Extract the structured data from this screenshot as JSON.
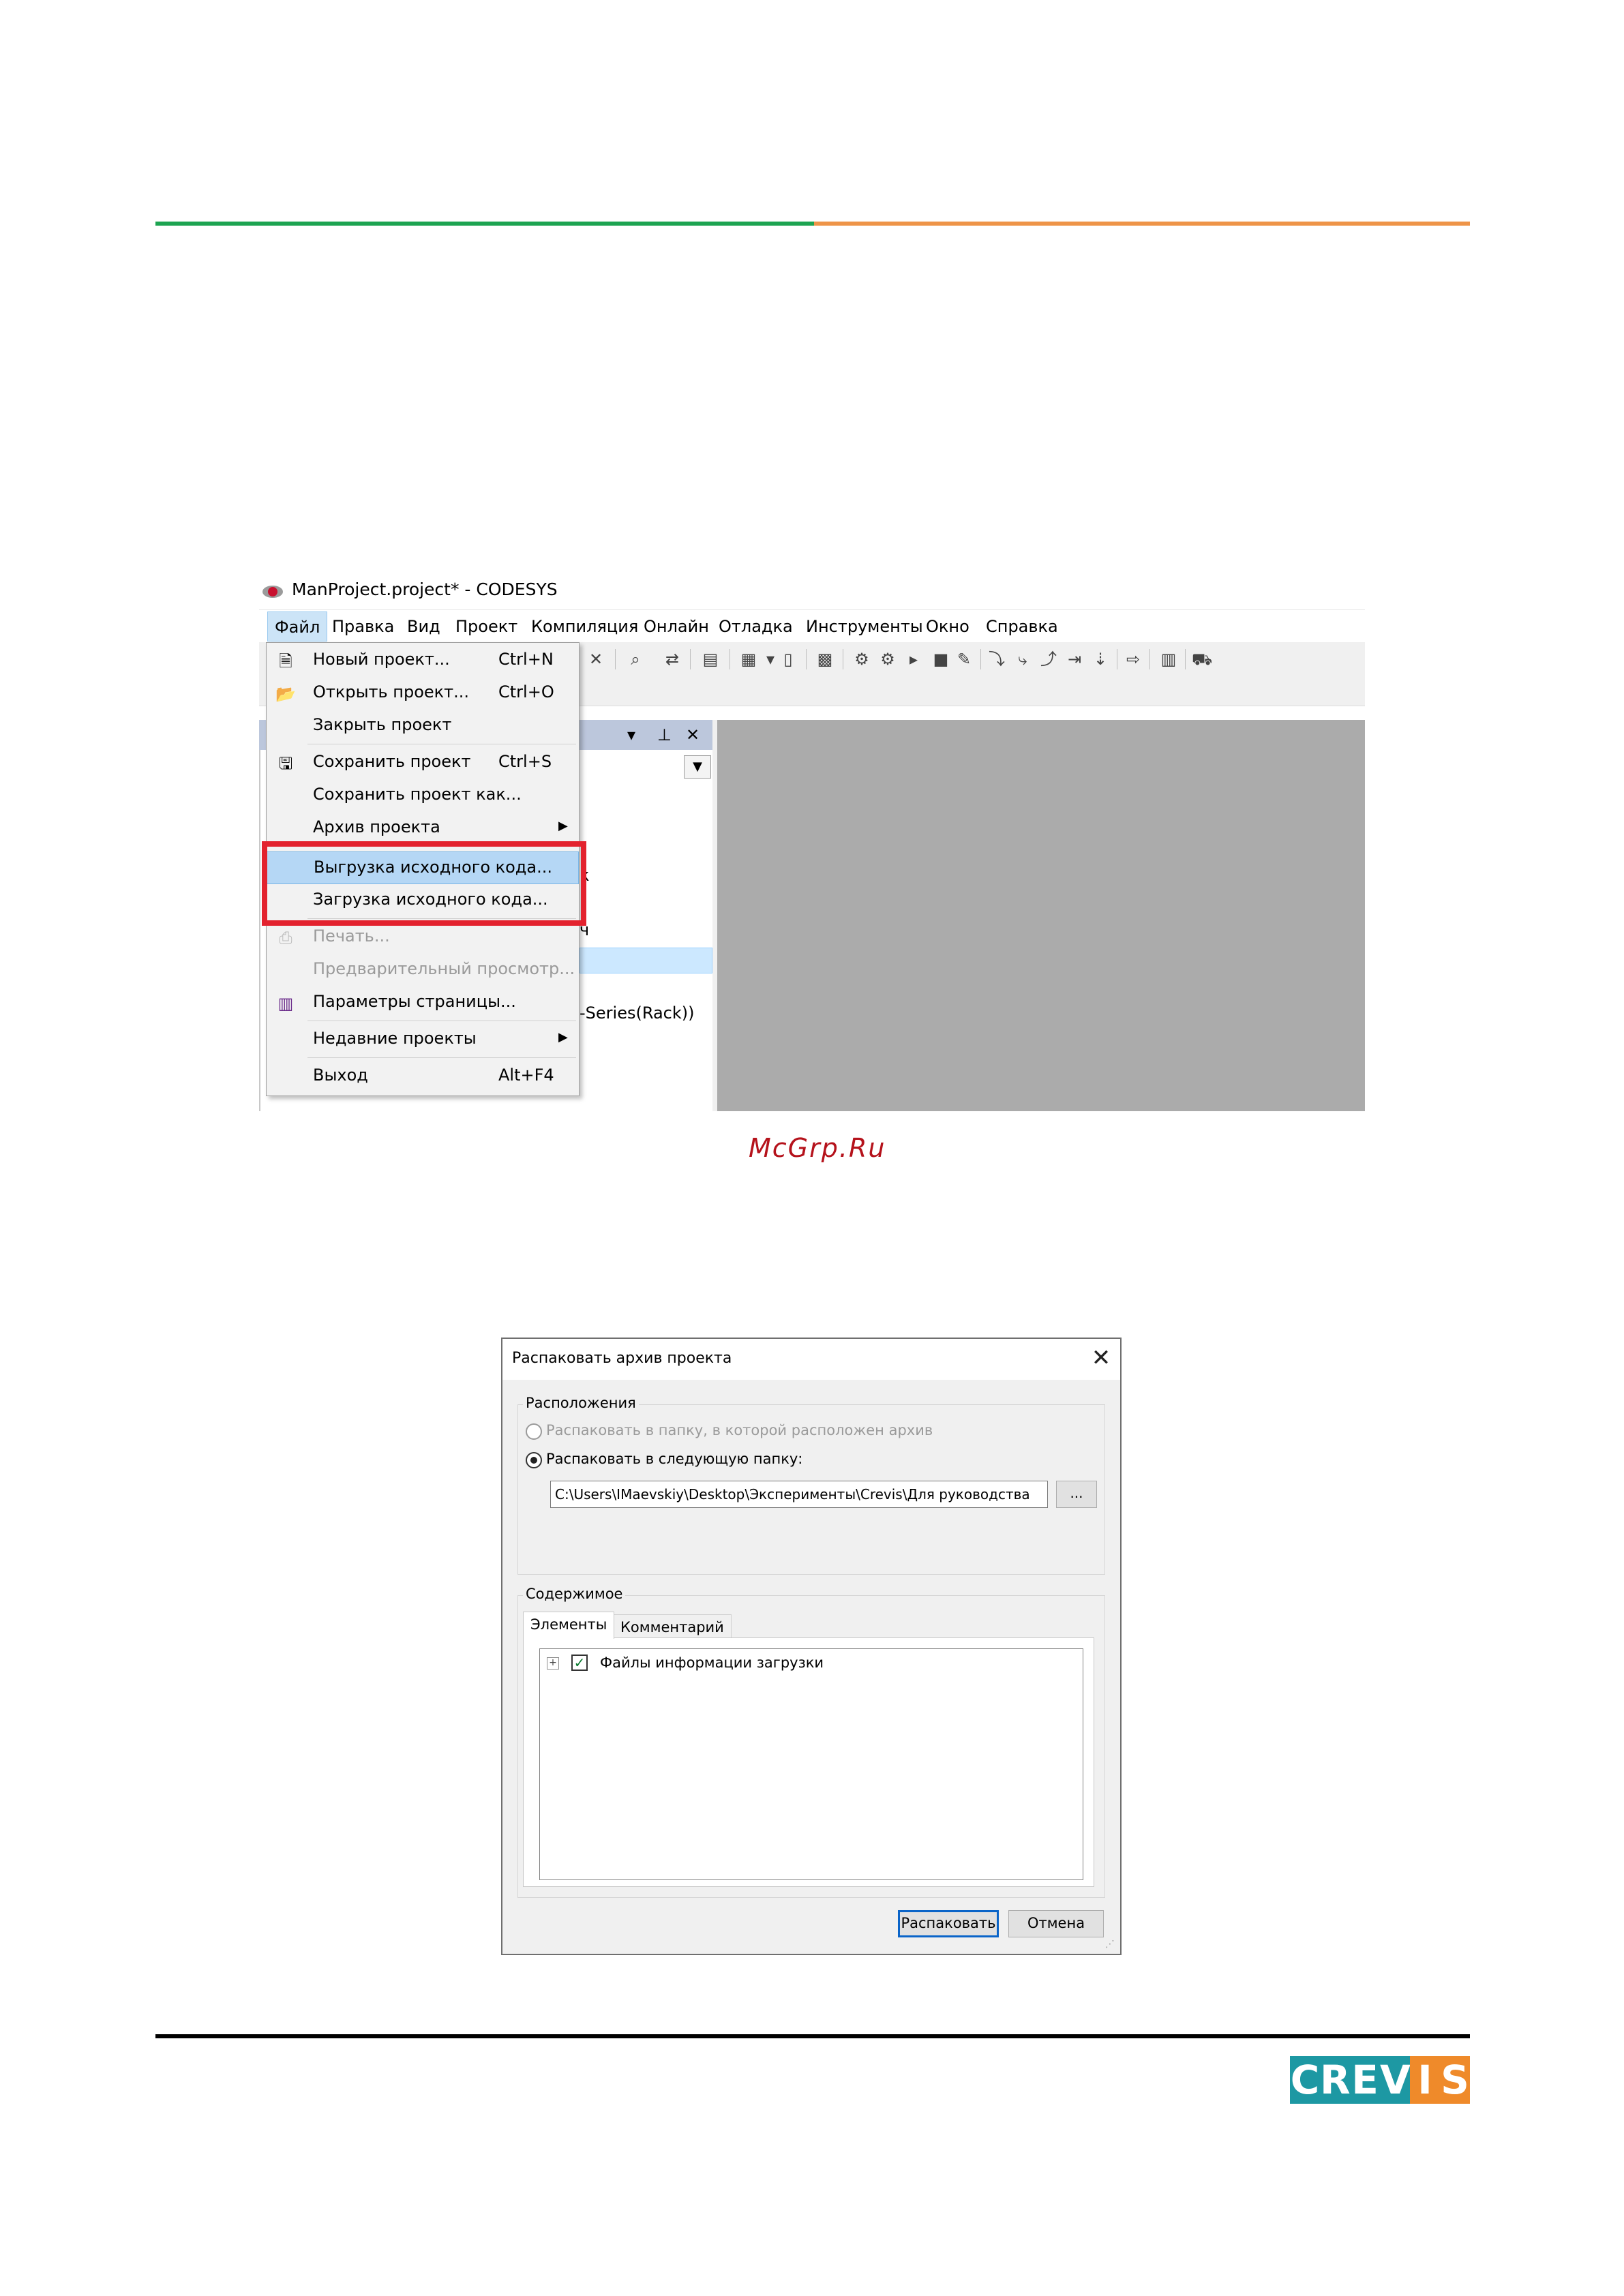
{
  "codesys": {
    "window_title": "ManProject.project* - CODESYS",
    "menubar": [
      "Файл",
      "Правка",
      "Вид",
      "Проект",
      "Компиляция",
      "Онлайн",
      "Отладка",
      "Инструменты",
      "Окно",
      "Справка"
    ],
    "file_menu": {
      "new": {
        "label": "Новый проект...",
        "shortcut": "Ctrl+N"
      },
      "open": {
        "label": "Открыть проект...",
        "shortcut": "Ctrl+O"
      },
      "close": {
        "label": "Закрыть проект"
      },
      "save": {
        "label": "Сохранить проект",
        "shortcut": "Ctrl+S"
      },
      "save_as": {
        "label": "Сохранить проект как..."
      },
      "archive": {
        "label": "Архив проекта"
      },
      "export_source": {
        "label": "Выгрузка исходного кода..."
      },
      "import_source": {
        "label": "Загрузка исходного кода..."
      },
      "print": {
        "label": "Печать..."
      },
      "preview": {
        "label": "Предварительный просмотр..."
      },
      "page_setup": {
        "label": "Параметры страницы..."
      },
      "recent": {
        "label": "Недавние проекты"
      },
      "exit": {
        "label": "Выход",
        "shortcut": "Alt+F4"
      }
    },
    "tree_fragments": {
      "frag1": "к",
      "frag2": "ч",
      "frag3": "-Series(Rack))"
    }
  },
  "watermark": "McGrp.Ru",
  "dialog": {
    "title": "Распаковать архив проекта",
    "locations_group": "Расположения",
    "radio_same_folder": "Распаковать в папку, в которой расположен архив",
    "radio_following_folder": "Распаковать в следующую папку:",
    "path_value": "C:\\Users\\IMaevskiy\\Desktop\\Эксперименты\\Crevis\\Для руководства",
    "browse_label": "...",
    "contents_group": "Содержимое",
    "tabs": [
      "Элементы",
      "Комментарий"
    ],
    "tree_item": "Файлы информации загрузки",
    "extract_button": "Распаковать",
    "cancel_button": "Отмена"
  },
  "logo": {
    "letters": [
      "C",
      "R",
      "E",
      "V",
      "I",
      "S"
    ],
    "colors": {
      "teal": "#1d98a3",
      "orange": "#ef8a2a"
    }
  }
}
